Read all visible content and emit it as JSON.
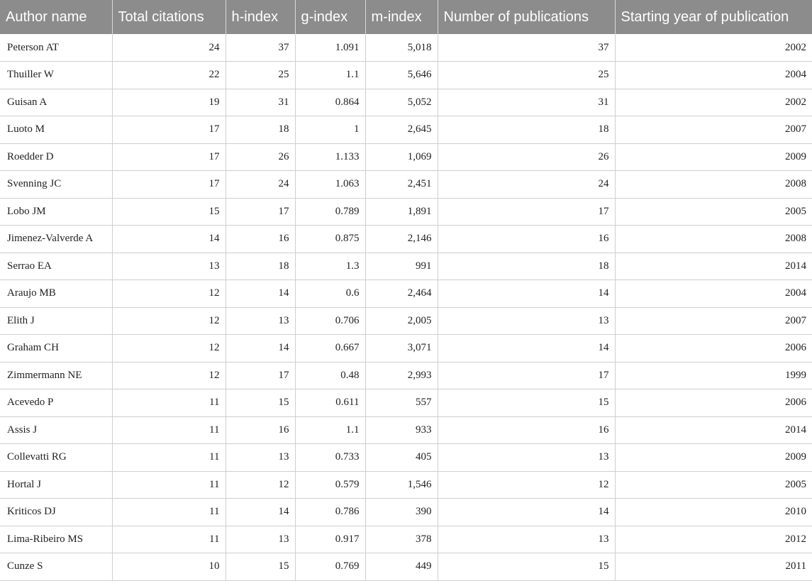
{
  "table": {
    "headers": [
      "Author name",
      "Total citations",
      "h-index",
      "g-index",
      "m-index",
      "Number of publications",
      "Starting year of publication"
    ],
    "rows": [
      [
        "Peterson AT",
        "24",
        "37",
        "1.091",
        "5,018",
        "37",
        "2002"
      ],
      [
        "Thuiller W",
        "22",
        "25",
        "1.1",
        "5,646",
        "25",
        "2004"
      ],
      [
        "Guisan A",
        "19",
        "31",
        "0.864",
        "5,052",
        "31",
        "2002"
      ],
      [
        "Luoto M",
        "17",
        "18",
        "1",
        "2,645",
        "18",
        "2007"
      ],
      [
        "Roedder D",
        "17",
        "26",
        "1.133",
        "1,069",
        "26",
        "2009"
      ],
      [
        "Svenning JC",
        "17",
        "24",
        "1.063",
        "2,451",
        "24",
        "2008"
      ],
      [
        "Lobo JM",
        "15",
        "17",
        "0.789",
        "1,891",
        "17",
        "2005"
      ],
      [
        "Jimenez-Valverde A",
        "14",
        "16",
        "0.875",
        "2,146",
        "16",
        "2008"
      ],
      [
        "Serrao EA",
        "13",
        "18",
        "1.3",
        "991",
        "18",
        "2014"
      ],
      [
        "Araujo MB",
        "12",
        "14",
        "0.6",
        "2,464",
        "14",
        "2004"
      ],
      [
        "Elith J",
        "12",
        "13",
        "0.706",
        "2,005",
        "13",
        "2007"
      ],
      [
        "Graham CH",
        "12",
        "14",
        "0.667",
        "3,071",
        "14",
        "2006"
      ],
      [
        "Zimmermann NE",
        "12",
        "17",
        "0.48",
        "2,993",
        "17",
        "1999"
      ],
      [
        "Acevedo P",
        "11",
        "15",
        "0.611",
        "557",
        "15",
        "2006"
      ],
      [
        "Assis J",
        "11",
        "16",
        "1.1",
        "933",
        "16",
        "2014"
      ],
      [
        "Collevatti RG",
        "11",
        "13",
        "0.733",
        "405",
        "13",
        "2009"
      ],
      [
        "Hortal J",
        "11",
        "12",
        "0.579",
        "1,546",
        "12",
        "2005"
      ],
      [
        "Kriticos DJ",
        "11",
        "14",
        "0.786",
        "390",
        "14",
        "2010"
      ],
      [
        "Lima-Ribeiro MS",
        "11",
        "13",
        "0.917",
        "378",
        "13",
        "2012"
      ],
      [
        "Cunze S",
        "10",
        "15",
        "0.769",
        "449",
        "15",
        "2011"
      ]
    ],
    "colors": {
      "header_background": "#8c8c8c",
      "header_text": "#ffffff",
      "grid_line": "#cfcfcf",
      "body_text": "#222222"
    }
  }
}
